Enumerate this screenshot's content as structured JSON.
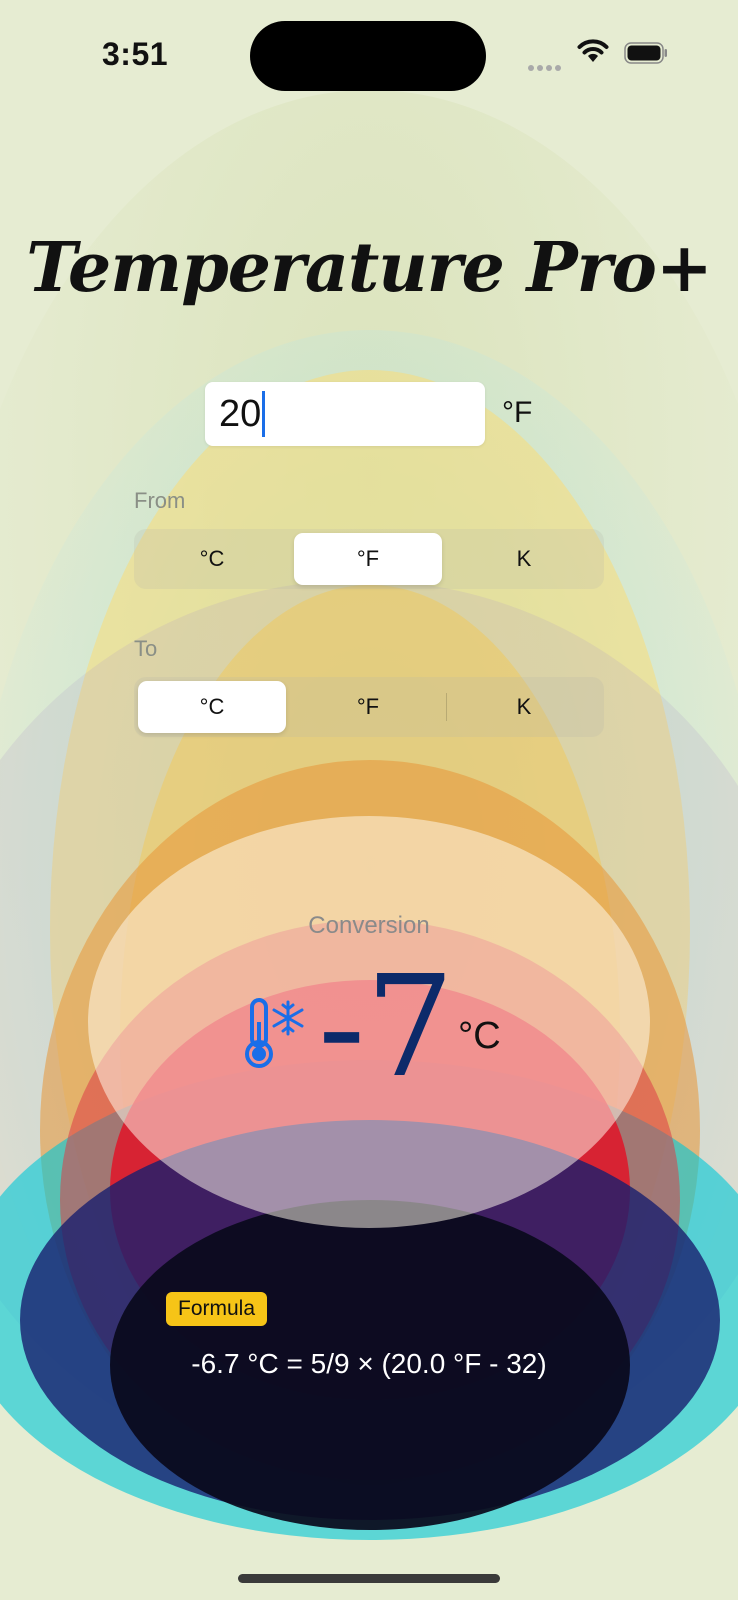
{
  "status_bar": {
    "time": "3:51"
  },
  "app": {
    "title": "Temperature Pro+"
  },
  "input": {
    "value": "20",
    "unit": "°F"
  },
  "from": {
    "label": "From",
    "options": [
      "°C",
      "°F",
      "K"
    ],
    "selected": "°F"
  },
  "to": {
    "label": "To",
    "options": [
      "°C",
      "°F",
      "K"
    ],
    "selected": "°C"
  },
  "conversion": {
    "label": "Conversion",
    "icon": "thermometer-snowflake-icon",
    "value": "-7",
    "unit": "°C"
  },
  "formula": {
    "badge": "Formula",
    "text": "-6.7 °C =  5/9 × (20.0 °F - 32)"
  },
  "colors": {
    "accent": "#1a6ee8",
    "badge": "#f6c417",
    "value": "#0c2a6a"
  }
}
